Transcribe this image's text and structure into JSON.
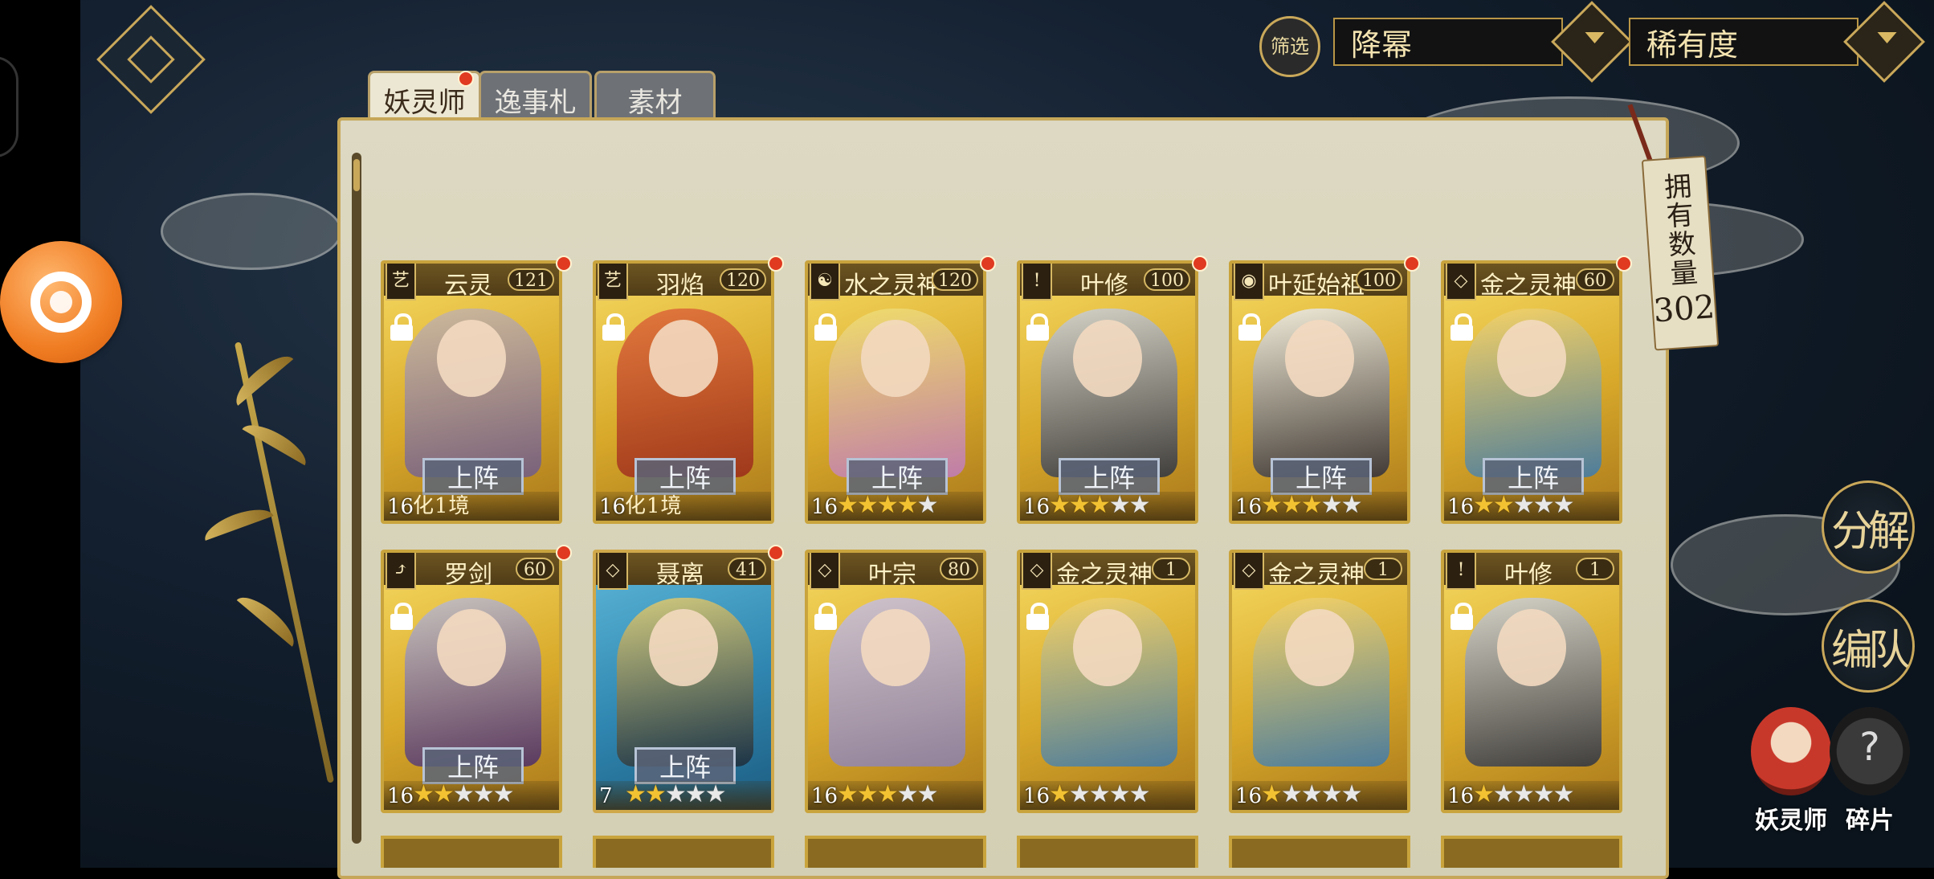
{
  "filter": {
    "badge_label": "筛选",
    "sort_value": "降幂",
    "sort_by_value": "稀有度"
  },
  "tabs": [
    {
      "label": "妖灵师",
      "active": true,
      "has_dot": true
    },
    {
      "label": "逸事札",
      "active": false,
      "has_dot": false
    },
    {
      "label": "素材",
      "active": false,
      "has_dot": false
    }
  ],
  "owned": {
    "label": "拥有数量",
    "value": "302"
  },
  "deploy_label": "上阵",
  "cards": [
    {
      "name": "云灵",
      "level": "121",
      "emblem": "艺",
      "count": "16",
      "stars_on": 0,
      "awaken_text": "化1境",
      "locked": true,
      "deploy": true,
      "dot": true,
      "blue": false
    },
    {
      "name": "羽焰",
      "level": "120",
      "emblem": "艺",
      "count": "16",
      "stars_on": 0,
      "awaken_text": "化1境",
      "locked": true,
      "deploy": true,
      "dot": true,
      "blue": false
    },
    {
      "name": "水之灵神",
      "level": "120",
      "emblem": "☯",
      "count": "16",
      "stars_on": 4,
      "awaken_text": "",
      "locked": true,
      "deploy": true,
      "dot": true,
      "blue": false
    },
    {
      "name": "叶修",
      "level": "100",
      "emblem": "!",
      "count": "16",
      "stars_on": 3,
      "awaken_text": "",
      "locked": true,
      "deploy": true,
      "dot": true,
      "blue": false
    },
    {
      "name": "叶延始祖",
      "level": "100",
      "emblem": "◉",
      "count": "16",
      "stars_on": 3,
      "awaken_text": "",
      "locked": true,
      "deploy": true,
      "dot": true,
      "blue": false
    },
    {
      "name": "金之灵神",
      "level": "60",
      "emblem": "◇",
      "count": "16",
      "stars_on": 2,
      "awaken_text": "",
      "locked": true,
      "deploy": true,
      "dot": true,
      "blue": false
    },
    {
      "name": "罗剑",
      "level": "60",
      "emblem": "⤴",
      "count": "16",
      "stars_on": 2,
      "awaken_text": "",
      "locked": true,
      "deploy": true,
      "dot": true,
      "blue": false
    },
    {
      "name": "聂离",
      "level": "41",
      "emblem": "◇",
      "count": "7",
      "stars_on": 2,
      "awaken_text": "",
      "locked": false,
      "deploy": true,
      "dot": true,
      "blue": true
    },
    {
      "name": "叶宗",
      "level": "80",
      "emblem": "◇",
      "count": "16",
      "stars_on": 3,
      "awaken_text": "",
      "locked": true,
      "deploy": false,
      "dot": false,
      "blue": false
    },
    {
      "name": "金之灵神",
      "level": "1",
      "emblem": "◇",
      "count": "16",
      "stars_on": 1,
      "awaken_text": "",
      "locked": true,
      "deploy": false,
      "dot": false,
      "blue": false
    },
    {
      "name": "金之灵神",
      "level": "1",
      "emblem": "◇",
      "count": "16",
      "stars_on": 1,
      "awaken_text": "",
      "locked": false,
      "deploy": false,
      "dot": false,
      "blue": false
    },
    {
      "name": "叶修",
      "level": "1",
      "emblem": "!",
      "count": "16",
      "stars_on": 1,
      "awaken_text": "",
      "locked": true,
      "deploy": false,
      "dot": false,
      "blue": false
    }
  ],
  "side_buttons": {
    "decompose": "分解",
    "formation": "编队"
  },
  "bottom_tabs": [
    {
      "label": "妖灵师"
    },
    {
      "label": "碎片"
    }
  ],
  "colors": {
    "accent_gold": "#c9a85a",
    "notification_red": "#e03a20",
    "card_gold": "#d8a92a",
    "card_blue": "#2f86b0"
  }
}
